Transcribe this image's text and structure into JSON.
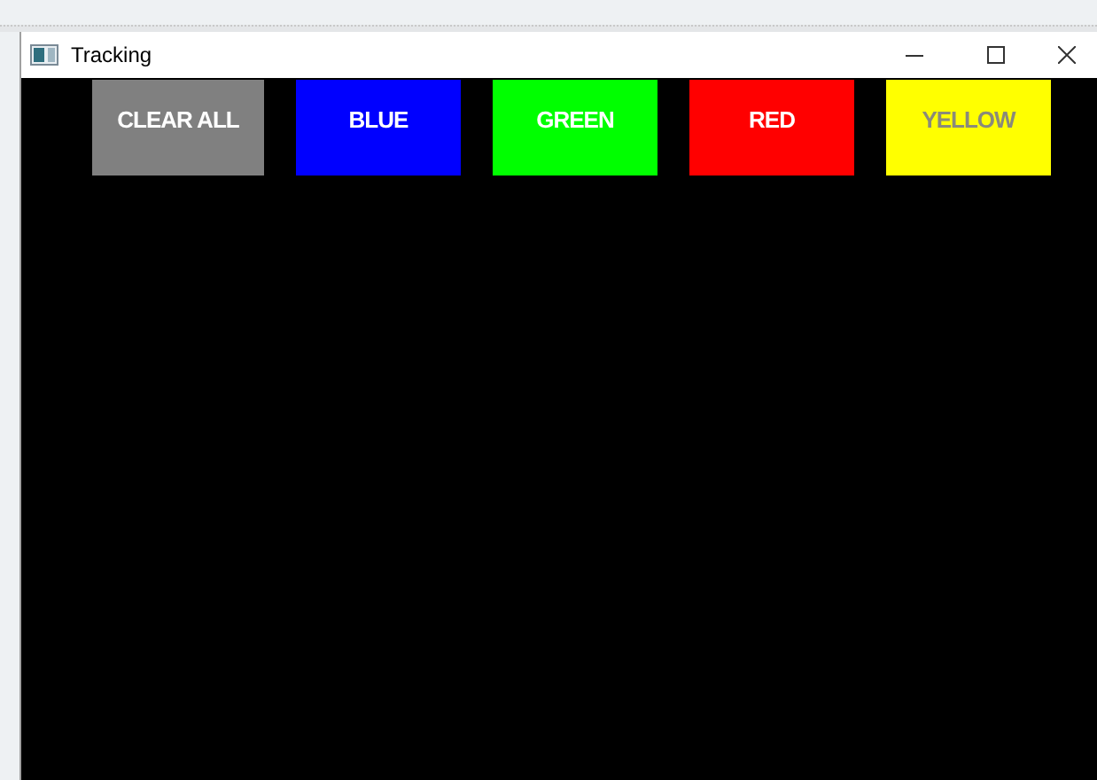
{
  "window": {
    "title": "Tracking"
  },
  "buttons": [
    {
      "label": "CLEAR ALL",
      "color": "#808080",
      "kind": "light"
    },
    {
      "label": "BLUE",
      "color": "#0000ff",
      "kind": "light"
    },
    {
      "label": "GREEN",
      "color": "#00ff00",
      "kind": "light"
    },
    {
      "label": "RED",
      "color": "#ff0000",
      "kind": "light"
    },
    {
      "label": "YELLOW",
      "color": "#ffff00",
      "kind": "dim"
    }
  ]
}
